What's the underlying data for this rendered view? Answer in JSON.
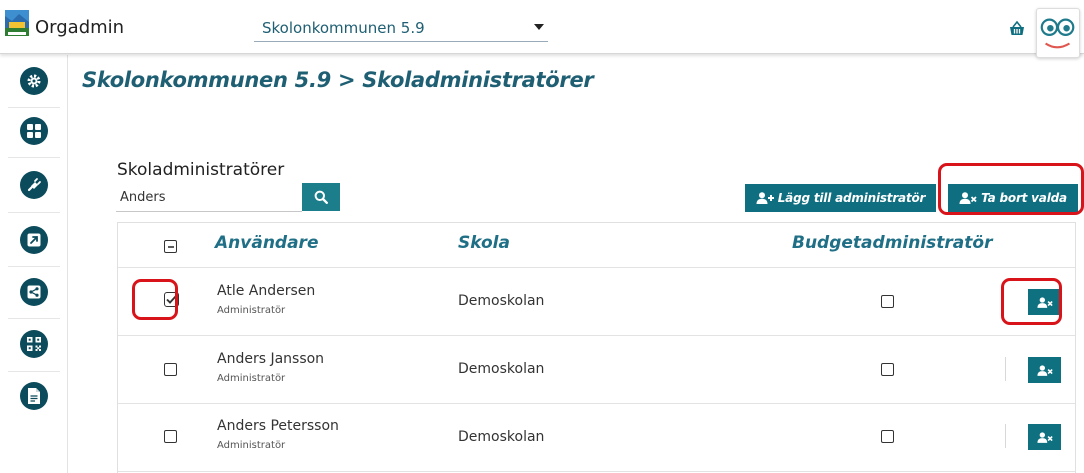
{
  "header": {
    "app_title": "Orgadmin",
    "org_selector_value": "Skolonkommunen 5.9",
    "icons": [
      "municipality-logo",
      "basket-icon",
      "mascot-avatar-icon"
    ]
  },
  "sidebar": {
    "items": [
      {
        "name": "settings",
        "icon": "gear-icon"
      },
      {
        "name": "dashboard",
        "icon": "grid-icon"
      },
      {
        "name": "integrations",
        "icon": "plug-icon"
      },
      {
        "name": "external-link",
        "icon": "external-link-icon"
      },
      {
        "name": "share",
        "icon": "share-icon"
      },
      {
        "name": "qr-code",
        "icon": "qr-code-icon"
      },
      {
        "name": "document",
        "icon": "document-icon"
      }
    ],
    "accent_color": "#0b4b5b"
  },
  "main": {
    "breadcrumb": "Skolonkommunen 5.9 > Skoladministratörer",
    "section_title": "Skoladministratörer",
    "search": {
      "value": "Anders",
      "icon": "search-icon"
    },
    "buttons": {
      "add_admin": "Lägg till administratör",
      "remove_selected": "Ta bort valda"
    },
    "table": {
      "columns": [
        "Användare",
        "Skola",
        "Budgetadministratör"
      ],
      "rows": [
        {
          "name": "Atle Andersen",
          "role": "Administratör",
          "school": "Demoskolan",
          "selected": true,
          "budget_admin": false
        },
        {
          "name": "Anders Jansson",
          "role": "Administratör",
          "school": "Demoskolan",
          "selected": false,
          "budget_admin": false
        },
        {
          "name": "Anders Petersson",
          "role": "Administratör",
          "school": "Demoskolan",
          "selected": false,
          "budget_admin": false
        }
      ]
    },
    "colors": {
      "primary": "#0f6f80",
      "heading": "#1f5f73",
      "highlight": "#d8141a"
    }
  }
}
